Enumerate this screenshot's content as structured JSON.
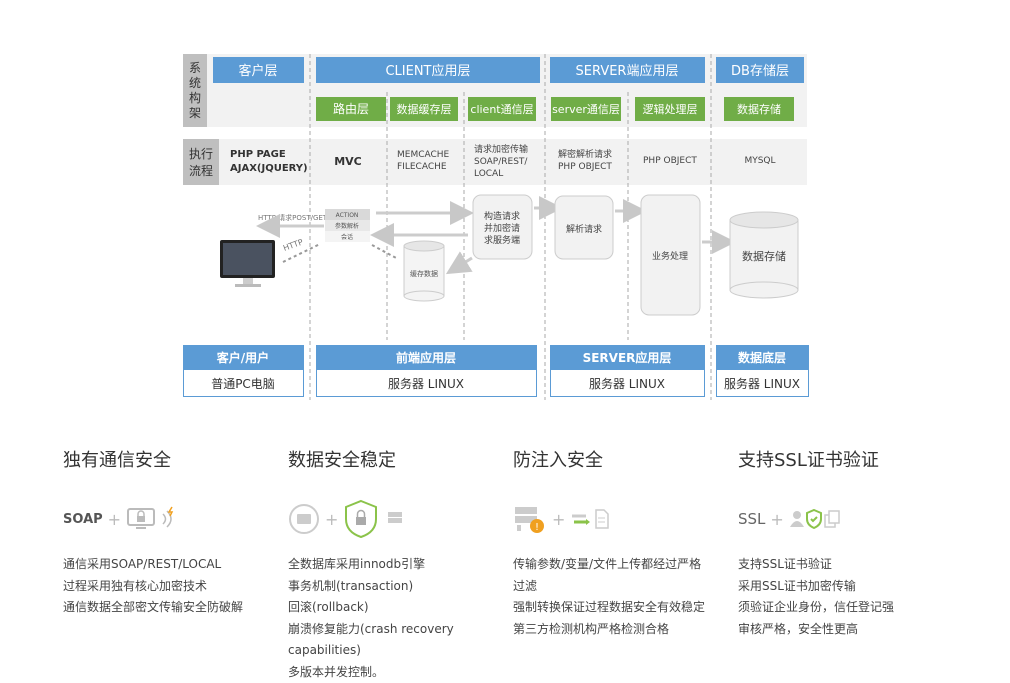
{
  "diagram": {
    "side_label_top": [
      "系",
      "统",
      "构",
      "架"
    ],
    "side_label_exec": [
      "执行",
      "流程"
    ],
    "layers": {
      "client": "客户层",
      "app": "CLIENT应用层",
      "server": "SERVER端应用层",
      "db": "DB存储层"
    },
    "sublayers": [
      "路由层",
      "数据缓存层",
      "client通信层",
      "server通信层",
      "逻辑处理层",
      "数据存储"
    ],
    "exec": {
      "client": [
        "PHP PAGE",
        "AJAX(JQUERY)"
      ],
      "route": "MVC",
      "cache": [
        "MEMCACHE",
        "FILECACHE"
      ],
      "client_comm": [
        "请求加密传输",
        "SOAP/REST/",
        "LOCAL"
      ],
      "server_comm": [
        "解密解析请求",
        "PHP OBJECT"
      ],
      "logic": "PHP OBJECT",
      "db": "MYSQL"
    },
    "flow": {
      "http_post": "HTTP 请求POST/GET",
      "http": "HTTP",
      "action": "ACTION",
      "param": "参数解析",
      "session": "会话",
      "cache_data": "缓存数据",
      "build_request": [
        "构造请求",
        "并加密请",
        "求服务端"
      ],
      "parse_request": "解析请求",
      "business": "业务处理",
      "data_store": "数据存储"
    },
    "bottom": [
      {
        "title": "客户/用户",
        "sub": "普通PC电脑"
      },
      {
        "title": "前端应用层",
        "sub": "服务器 LINUX"
      },
      {
        "title": "SERVER应用层",
        "sub": "服务器 LINUX"
      },
      {
        "title": "数据底层",
        "sub": "服务器 LINUX"
      }
    ]
  },
  "features": [
    {
      "title": "独有通信安全",
      "icon_text": "SOAP",
      "icons": [
        "monitor-lock-icon",
        "signal-icon"
      ],
      "lines": [
        "通信采用SOAP/REST/LOCAL",
        "过程采用独有核心加密技术",
        "通信数据全部密文传输安全防破解"
      ]
    },
    {
      "title": "数据安全稳定",
      "icon_text": "",
      "icons": [
        "drive-icon",
        "shield-lock-icon",
        "database-icon"
      ],
      "lines": [
        "全数据库采用innodb引擎",
        "事务机制(transaction)",
        "回滚(rollback)",
        "崩溃修复能力(crash recovery",
        "capabilities)",
        "多版本并发控制。"
      ]
    },
    {
      "title": "防注入安全",
      "icon_text": "",
      "icons": [
        "server-alert-icon",
        "transfer-doc-icon"
      ],
      "lines": [
        "传输参数/变量/文件上传都经过严格",
        "过滤",
        "强制转换保证过程数据安全有效稳定",
        "第三方检测机构严格检测合格"
      ]
    },
    {
      "title": "支持SSL证书验证",
      "icon_text": "SSL",
      "icons": [
        "user-icon",
        "shield-check-icon",
        "copy-icon"
      ],
      "lines": [
        "支持SSL证书验证",
        "采用SSL证书加密传输",
        "须验证企业身份，信任登记强",
        "审核严格，安全性更高"
      ]
    }
  ],
  "colors": {
    "blue": "#5b9bd5",
    "green": "#70ad47",
    "gray_band": "#f2f2f2",
    "label_gray": "#bfbfbf"
  }
}
